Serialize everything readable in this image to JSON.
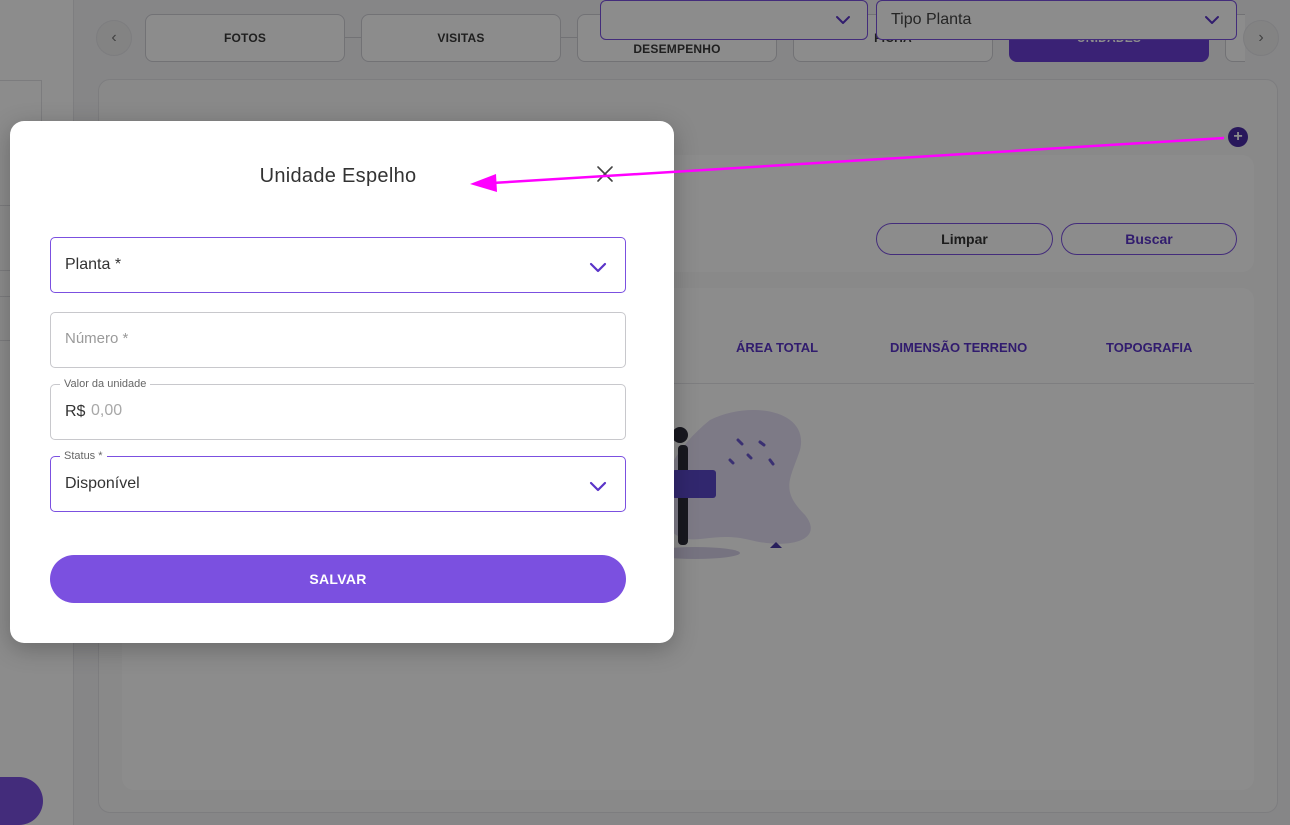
{
  "tabs": {
    "items": [
      {
        "label": "FOTOS"
      },
      {
        "label": "VISITAS"
      },
      {
        "label": "AVALIAÇÕES E DESEMPENHO"
      },
      {
        "label": "FICHA"
      },
      {
        "label": "UNIDADES",
        "active": true
      }
    ],
    "prev_icon": "chevron-left-icon",
    "next_icon": "chevron-right-icon"
  },
  "filters": {
    "tipo_planta_label": "Tipo Planta",
    "clear_label": "Limpar",
    "search_label": "Buscar"
  },
  "table": {
    "headers": [
      "ÁREA TOTAL",
      "DIMENSÃO TERRENO",
      "TOPOGRAFIA"
    ]
  },
  "modal": {
    "title": "Unidade Espelho",
    "close_icon": "close-icon",
    "planta": {
      "label": "Planta *"
    },
    "numero": {
      "placeholder": "Número *"
    },
    "valor": {
      "legend": "Valor da unidade",
      "currency": "R$",
      "placeholder": "0,00"
    },
    "status": {
      "legend": "Status *",
      "value": "Disponível"
    },
    "save_label": "SALVAR"
  },
  "colors": {
    "accent": "#7b50e0",
    "accent_dark": "#6a3fd6",
    "annotation": "#ff00ff"
  }
}
